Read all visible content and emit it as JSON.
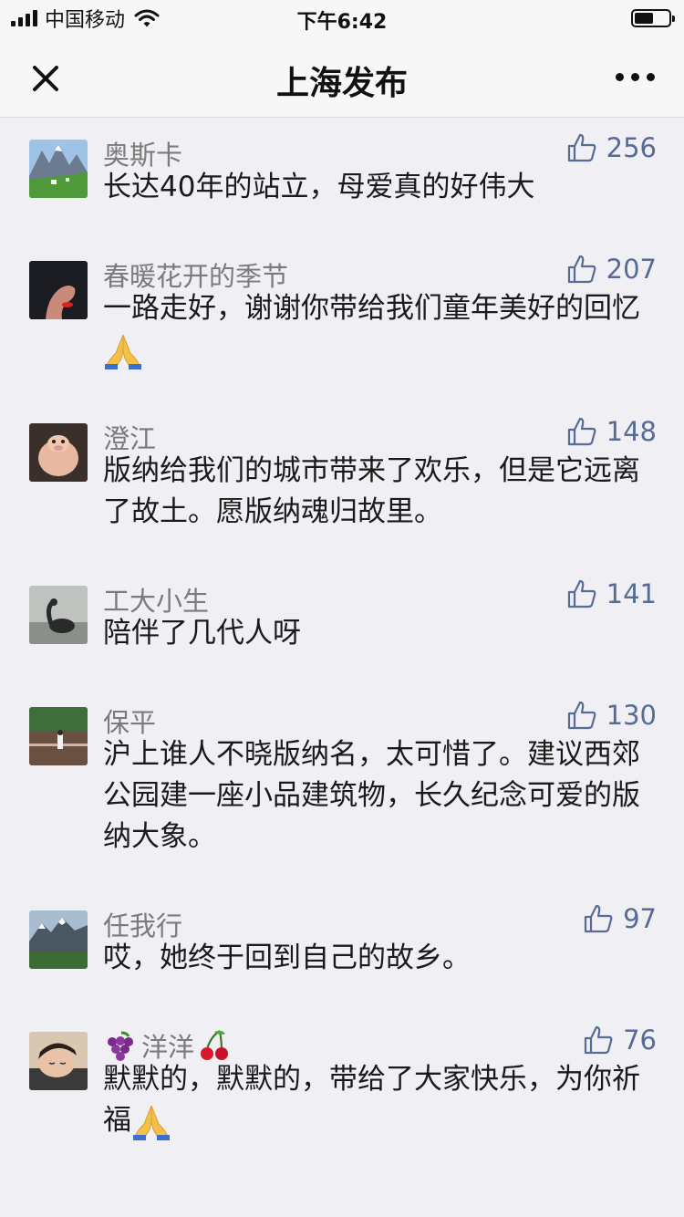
{
  "status_bar": {
    "carrier": "中国移动",
    "time": "下午6:42"
  },
  "nav": {
    "title": "上海发布"
  },
  "comments": [
    {
      "name": "奥斯卡",
      "likes": "256",
      "text": "长达40年的站立，母爱真的好伟大",
      "avatar": "mountain-meadow"
    },
    {
      "name": "春暖花开的季节",
      "likes": "207",
      "text": "一路走好，谢谢你带给我们童年美好的回忆",
      "emoji_after": "pray",
      "avatar": "hand"
    },
    {
      "name": "澄江",
      "likes": "148",
      "text": "版纳给我们的城市带来了欢乐，但是它远离了故土。愿版纳魂归故里。",
      "avatar": "pig"
    },
    {
      "name": "工大小生",
      "likes": "141",
      "text": "陪伴了几代人呀",
      "avatar": "swan"
    },
    {
      "name": "保平",
      "likes": "130",
      "text": "沪上谁人不晓版纳名，太可惜了。建议西郊公园建一座小品建筑物，长久纪念可爱的版纳大象。",
      "avatar": "lake-person"
    },
    {
      "name": "任我行",
      "likes": "97",
      "text": "哎，她终于回到自己的故乡。",
      "avatar": "mountain-snow"
    },
    {
      "name": "洋洋",
      "name_prefix_emoji": "grapes",
      "name_suffix_emoji": "cherries",
      "likes": "76",
      "text": "默默的，默默的，带给了大家快乐，为你祈福",
      "emoji_after": "pray",
      "avatar": "sleeping-child"
    }
  ],
  "colors": {
    "background": "#efeff4",
    "link_blue": "#576b95",
    "name_gray": "#7b7b7b"
  }
}
